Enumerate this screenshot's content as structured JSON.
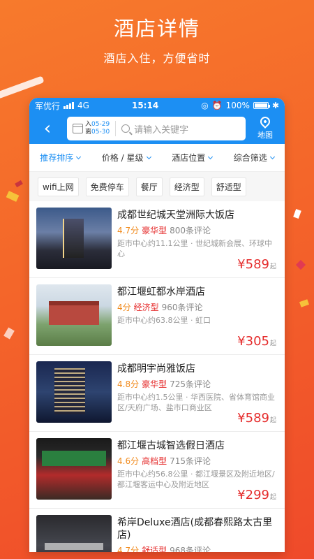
{
  "promo": {
    "title": "酒店详情",
    "subtitle": "酒店入住，方便省时"
  },
  "status_bar": {
    "carrier": "军优行",
    "network": "4G",
    "time": "15:14",
    "battery": "100%"
  },
  "nav": {
    "checkin_label": "入",
    "checkin_date": "05-29",
    "checkout_label": "离",
    "checkout_date": "05-30",
    "search_placeholder": "请输入关键字",
    "map_label": "地图"
  },
  "filters": [
    {
      "label": "推荐排序",
      "active": true
    },
    {
      "label": "价格 / 星级",
      "active": false
    },
    {
      "label": "酒店位置",
      "active": false
    },
    {
      "label": "综合筛选",
      "active": false
    }
  ],
  "tags": [
    "wifi上网",
    "免费停车",
    "餐厅",
    "经济型",
    "舒适型"
  ],
  "hotels": [
    {
      "name": "成都世纪城天堂洲际大饭店",
      "score": "4.7分",
      "grade": "豪华型",
      "reviews": "800条评论",
      "location": "距市中心约11.1公里 · 世纪城新会展、环球中心",
      "price": "¥589",
      "price_suffix": "起"
    },
    {
      "name": "都江堰虹都水岸酒店",
      "score": "4分",
      "grade": "经济型",
      "reviews": "960条评论",
      "location": "距市中心约63.8公里 · 虹口",
      "price": "¥305",
      "price_suffix": "起"
    },
    {
      "name": "成都明宇尚雅饭店",
      "score": "4.8分",
      "grade": "豪华型",
      "reviews": "725条评论",
      "location": "距市中心约1.5公里 · 华西医院、省体育馆商业区/天府广场、盐市口商业区",
      "price": "¥589",
      "price_suffix": "起"
    },
    {
      "name": "都江堰古城智选假日酒店",
      "score": "4.6分",
      "grade": "高档型",
      "reviews": "715条评论",
      "location": "距市中心约56.8公里 · 都江堰景区及附近地区/都江堰客运中心及附近地区",
      "price": "¥299",
      "price_suffix": "起"
    },
    {
      "name": "希岸Deluxe酒店(成都春熙路太古里店)",
      "score": "4.7分",
      "grade": "舒适型",
      "reviews": "968条评论",
      "location": "",
      "price": "",
      "price_suffix": ""
    }
  ]
}
